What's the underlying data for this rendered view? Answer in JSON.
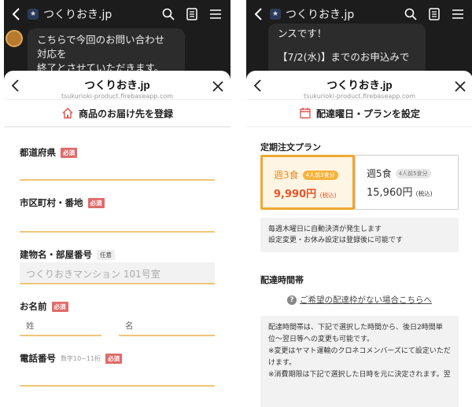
{
  "left": {
    "header": {
      "title": "つくりおき.jp"
    },
    "chat": {
      "line1": "こちらで今回のお問い合わせ",
      "line2": "対応を",
      "line3": "終了とさせていただきます。"
    },
    "sheet": {
      "title": "つくりおき.jp",
      "url": "tsukurioki-product.firebaseapp.com",
      "section": "商品のお届け先を登録",
      "fields": [
        {
          "label": "都道府県",
          "badge": "必須"
        },
        {
          "label": "市区町村・番地",
          "badge": "必須"
        },
        {
          "label": "建物名・部屋番号",
          "badge": "任意",
          "placeholder": "つくりおきマンション 101号室"
        },
        {
          "label": "お名前",
          "badge": "必須",
          "sub1": "姓",
          "sub2": "名"
        },
        {
          "label": "電話番号",
          "hint": "数字10~11桁",
          "badge": "必須"
        }
      ]
    }
  },
  "right": {
    "header": {
      "title": "つくりおき.jp"
    },
    "chat": {
      "line1": "ンスです！",
      "line2": "【7/2(水)】までのお申込みで"
    },
    "sheet": {
      "title": "つくりおき.jp",
      "url": "tsukurioki-product.firebaseapp.com",
      "section": "配達曜日・プランを設定",
      "plan_heading": "定期注文プラン",
      "plans": [
        {
          "name": "週3食",
          "badge": "4人前3食分",
          "price": "9,990円",
          "tax": "(税込)",
          "selected": true
        },
        {
          "name": "週5食",
          "badge": "4人前5食分",
          "price": "15,960円",
          "tax": "(税込)",
          "selected": false
        }
      ],
      "info1": "毎週木曜日に自動決済が発生します",
      "info2": "設定変更・お休み設定は登録後に可能です",
      "time_heading": "配達時間帯",
      "help_link": "ご希望の配達枠がない場合こちらへ",
      "note1": "配達時間帯は、下記で選択した時間から、後日2時間単",
      "note2": "位〜翌日等への変更も可能です。",
      "note3": "※変更はヤマト運輸のクロネコメンバーズにて設定いただ",
      "note4": "けます。",
      "note5": "※消費期限は下記で選択した日時を元に決定されます。翌"
    }
  },
  "colors": {
    "accent": "#f0a830",
    "required": "#e06b6b",
    "price": "#e8562a"
  }
}
